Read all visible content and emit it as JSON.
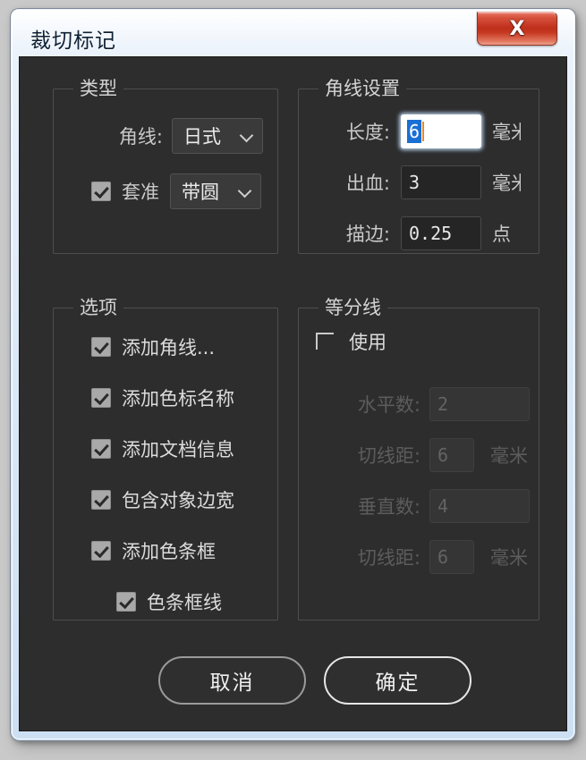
{
  "window": {
    "title": "裁切标记",
    "close_icon": "close-x-icon",
    "close_label": "X",
    "accent_close_red": "#bf2f1b",
    "frame_color": "#cfe0f2",
    "panel_color": "#2d2d2d"
  },
  "groups": {
    "type": {
      "title": "类型",
      "corner_line": {
        "label": "角线:",
        "value": "日式",
        "chevron": "chevron-down-icon"
      },
      "registration": {
        "checked": true,
        "label": "套准",
        "value": "带圆",
        "chevron": "chevron-down-icon"
      }
    },
    "corner_settings": {
      "title": "角线设置",
      "rows": [
        {
          "label": "长度:",
          "value": "6",
          "unit": "毫米",
          "focused": true,
          "disabled": false
        },
        {
          "label": "出血:",
          "value": "3",
          "unit": "毫米",
          "focused": false,
          "disabled": false
        },
        {
          "label": "描边:",
          "value": "0.25",
          "unit": "点",
          "focused": false,
          "disabled": false
        }
      ]
    },
    "options": {
      "title": "选项",
      "items": [
        {
          "label": "添加角线...",
          "checked": true,
          "indent": false
        },
        {
          "label": "添加色标名称",
          "checked": true,
          "indent": false
        },
        {
          "label": "添加文档信息",
          "checked": true,
          "indent": false
        },
        {
          "label": "包含对象边宽",
          "checked": true,
          "indent": false
        },
        {
          "label": "添加色条框",
          "checked": true,
          "indent": false
        },
        {
          "label": "色条框线",
          "checked": true,
          "indent": true
        }
      ]
    },
    "divider_lines": {
      "title": "等分线",
      "enable": {
        "label": "使用",
        "checked": false
      },
      "rows": [
        {
          "label": "水平数:",
          "value": "2",
          "unit": "",
          "disabled": true
        },
        {
          "label": "切线距:",
          "value": "6",
          "unit": "毫米",
          "disabled": true
        },
        {
          "label": "垂直数:",
          "value": "4",
          "unit": "",
          "disabled": true
        },
        {
          "label": "切线距:",
          "value": "6",
          "unit": "毫米",
          "disabled": true
        }
      ]
    }
  },
  "buttons": {
    "cancel": "取消",
    "ok": "确定"
  }
}
